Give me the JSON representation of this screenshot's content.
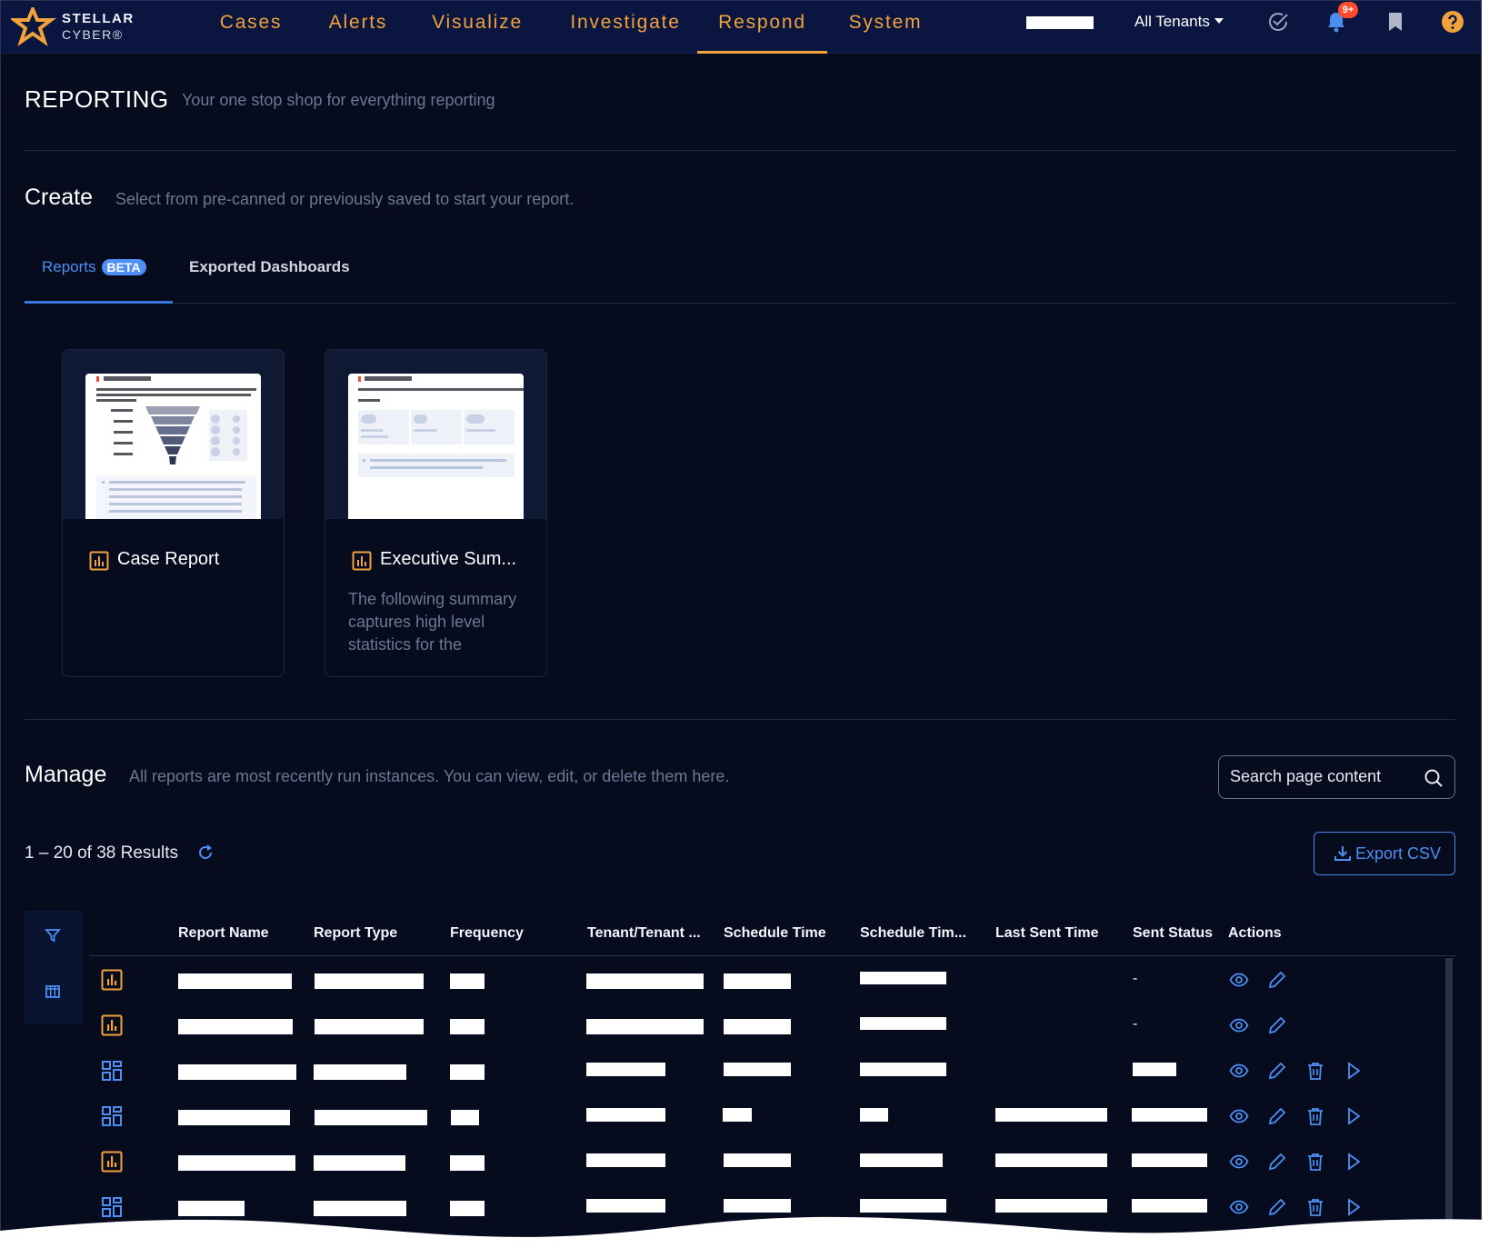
{
  "brand": {
    "line1": "STELLAR",
    "line2": "CYBER®"
  },
  "nav": {
    "items": [
      "Cases",
      "Alerts",
      "Visualize",
      "Investigate",
      "Respond",
      "System"
    ],
    "active": "Respond",
    "tenant_selector": "All Tenants",
    "notification_count": "9+"
  },
  "header": {
    "title": "REPORTING",
    "subtitle": "Your one stop shop for everything reporting"
  },
  "create": {
    "title": "Create",
    "subtitle": "Select from pre-canned or previously saved to start your report.",
    "tabs": [
      {
        "label": "Reports",
        "badge": "BETA",
        "active": true
      },
      {
        "label": "Exported Dashboards",
        "active": false
      }
    ],
    "cards": [
      {
        "title": "Case Report",
        "description": ""
      },
      {
        "title": "Executive Sum...",
        "description": "The following summary captures high level statistics for the"
      }
    ]
  },
  "manage": {
    "title": "Manage",
    "subtitle": "All reports are most recently run instances. You can view, edit, or delete them here.",
    "search_placeholder": "Search page content",
    "results_text": "1 – 20 of 38 Results",
    "export_label": "Export CSV"
  },
  "table": {
    "columns": [
      "Report Name",
      "Report Type",
      "Frequency",
      "Tenant/Tenant ...",
      "Schedule Time",
      "Schedule Tim...",
      "Last Sent Time",
      "Sent Status",
      "Actions"
    ],
    "rows": [
      {
        "type_icon": "chart-report-icon",
        "sent_status": "-",
        "actions": [
          "view",
          "edit"
        ]
      },
      {
        "type_icon": "chart-report-icon",
        "sent_status": "-",
        "actions": [
          "view",
          "edit"
        ]
      },
      {
        "type_icon": "dashboard-report-icon",
        "sent_status": "",
        "actions": [
          "view",
          "edit",
          "delete",
          "run"
        ]
      },
      {
        "type_icon": "dashboard-report-icon",
        "sent_status": "",
        "actions": [
          "view",
          "edit",
          "delete",
          "run"
        ]
      },
      {
        "type_icon": "chart-report-icon",
        "sent_status": "",
        "actions": [
          "view",
          "edit",
          "delete",
          "run"
        ]
      },
      {
        "type_icon": "dashboard-report-icon",
        "sent_status": "",
        "actions": [
          "view",
          "edit",
          "delete",
          "run"
        ]
      }
    ]
  },
  "colors": {
    "accent": "#f2a23a",
    "link": "#4d8ff5",
    "background": "#060b1e",
    "navbar": "#0a1640"
  }
}
